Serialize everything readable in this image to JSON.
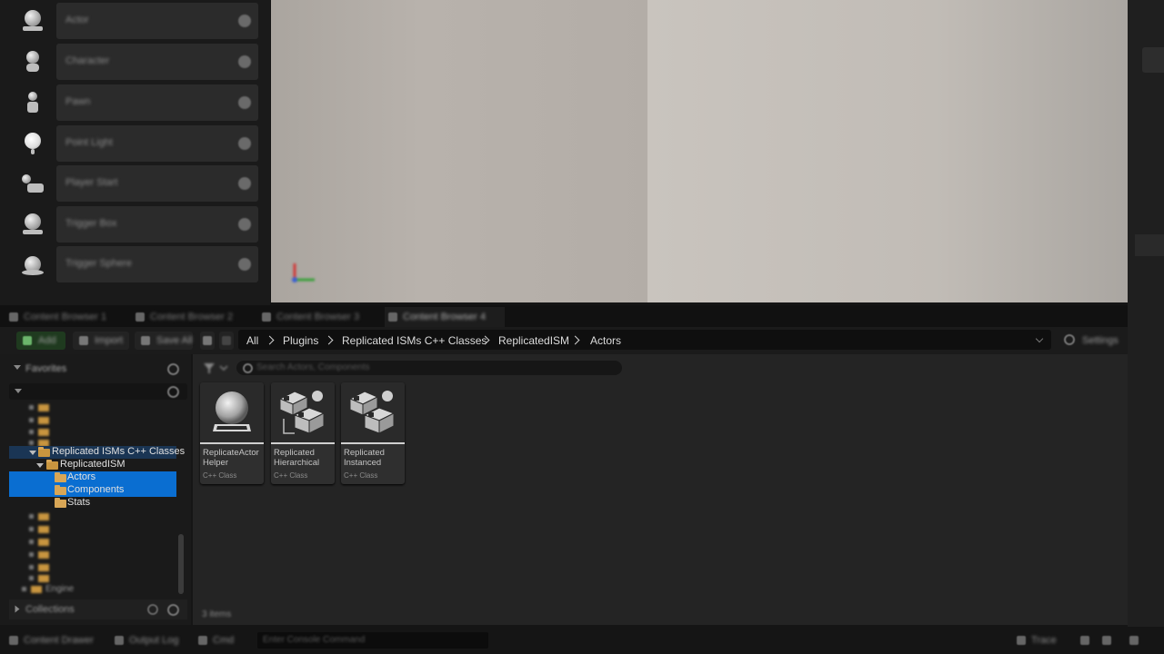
{
  "place_actors": {
    "items": [
      {
        "label": "Actor",
        "icon": "actor-icon"
      },
      {
        "label": "Character",
        "icon": "character-icon"
      },
      {
        "label": "Pawn",
        "icon": "pawn-icon"
      },
      {
        "label": "Point Light",
        "icon": "point-light-icon"
      },
      {
        "label": "Player Start",
        "icon": "player-start-icon"
      },
      {
        "label": "Trigger Box",
        "icon": "trigger-box-icon"
      },
      {
        "label": "Trigger Sphere",
        "icon": "trigger-sphere-icon"
      }
    ]
  },
  "content_browser": {
    "tabs": [
      {
        "label": "Content Browser 1",
        "active": false
      },
      {
        "label": "Content Browser 2",
        "active": false
      },
      {
        "label": "Content Browser 3",
        "active": false
      },
      {
        "label": "Content Browser 4",
        "active": true
      }
    ],
    "toolbar": {
      "add_label": "Add",
      "import_label": "Import",
      "save_all_label": "Save All",
      "settings_label": "Settings"
    },
    "breadcrumb": [
      "All",
      "Plugins",
      "Replicated ISMs C++ Classes",
      "ReplicatedISM",
      "Actors"
    ],
    "sources": {
      "favorites_label": "Favorites",
      "collections_label": "Collections",
      "tree": {
        "root": "Replicated ISMs C++ Classes",
        "module": "ReplicatedISM",
        "folders": [
          {
            "label": "Actors",
            "selected": true
          },
          {
            "label": "Components",
            "selected": true
          },
          {
            "label": "Stats",
            "selected": false
          }
        ],
        "engine_label": "Engine"
      }
    },
    "search_placeholder": "Search Actors, Components",
    "assets": [
      {
        "name": "ReplicateActor Helper",
        "type": "C++ Class",
        "icon": "actor-class-icon"
      },
      {
        "name": "Replicated Hierarchical",
        "type": "C++ Class",
        "icon": "hism-component-icon"
      },
      {
        "name": "Replicated Instanced",
        "type": "C++ Class",
        "icon": "ism-component-icon"
      }
    ],
    "item_count": "3 items"
  },
  "statusbar": {
    "content_drawer": "Content Drawer",
    "output_log": "Output Log",
    "cmd": "Cmd",
    "console_placeholder": "Enter Console Command",
    "trace": "Trace",
    "colors": {
      "selection": "#0a6ed1",
      "folder": "#d8a656"
    }
  }
}
